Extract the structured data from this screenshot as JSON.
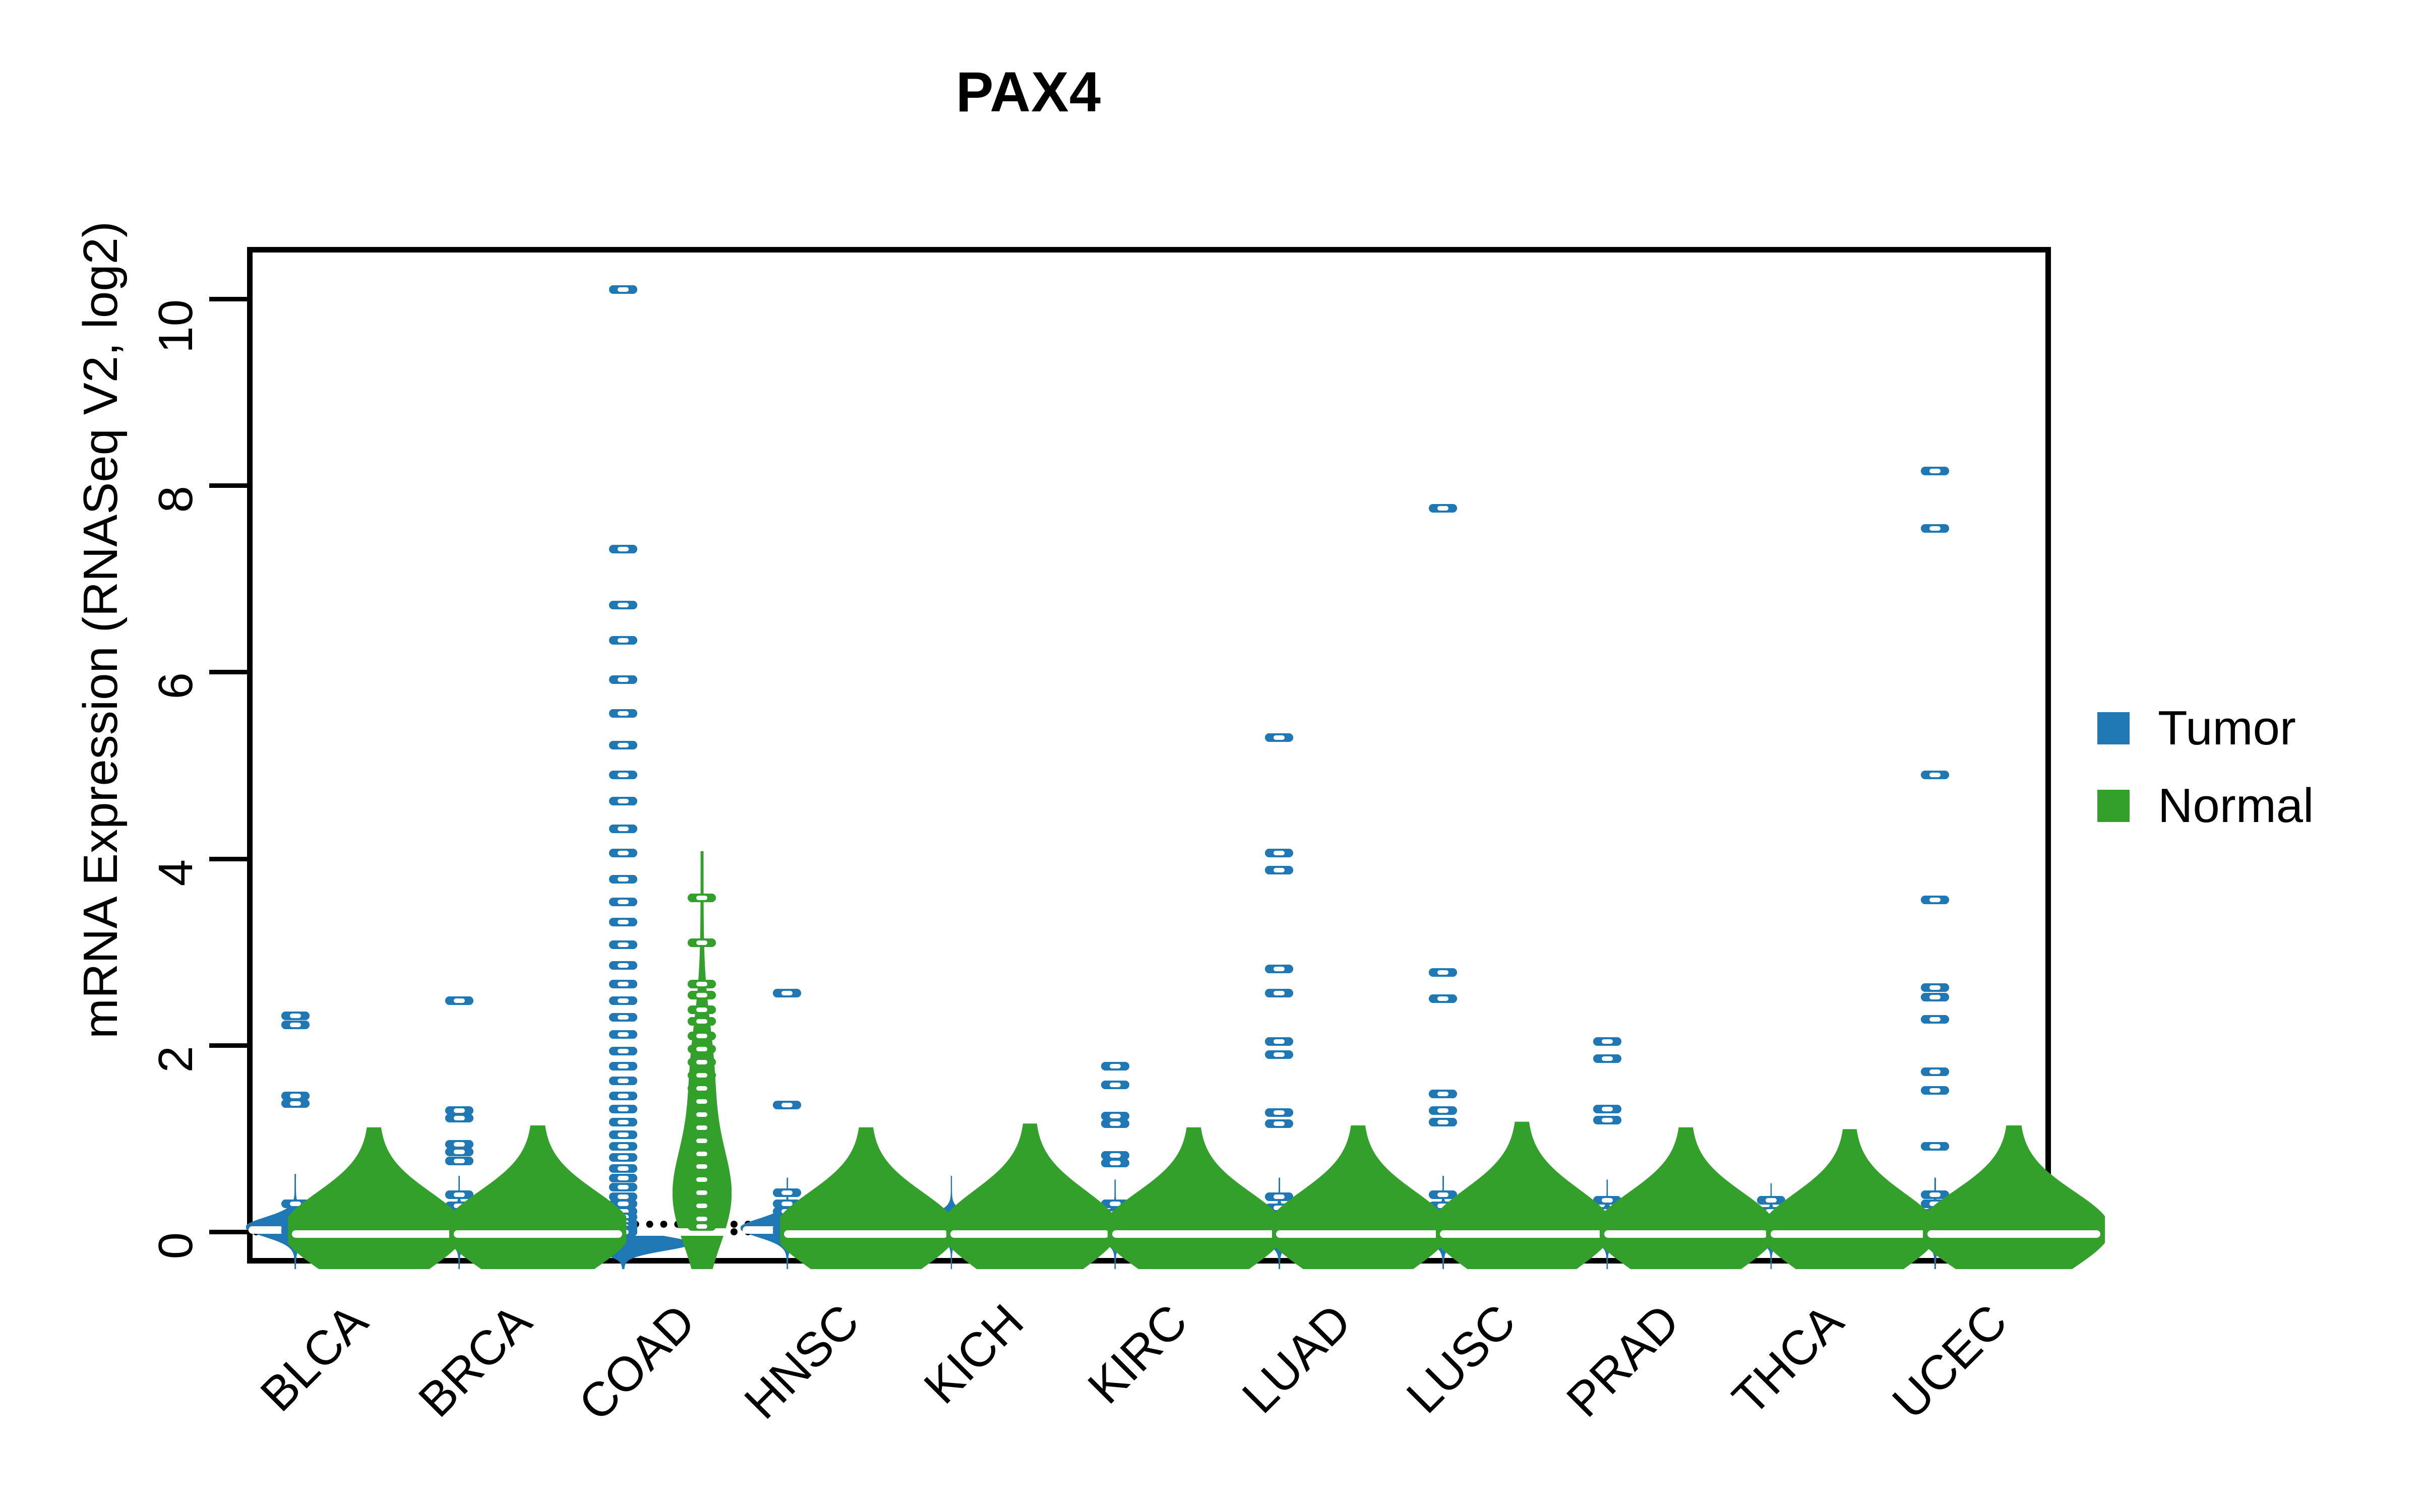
{
  "chart_data": {
    "type": "violin",
    "title": "PAX4",
    "xlabel": "",
    "ylabel": "mRNA Expression (RNASeq V2, log2)",
    "ylim": [
      -0.55,
      10.6
    ],
    "yticks": [
      0,
      2,
      4,
      6,
      8,
      10
    ],
    "ytick_labels": [
      "0",
      "2",
      "4",
      "6",
      "8",
      "10"
    ],
    "grid": false,
    "legend_position": "right",
    "categories": [
      "BLCA",
      "BRCA",
      "COAD",
      "HNSC",
      "KICH",
      "KIRC",
      "LUAD",
      "LUSC",
      "PRAD",
      "THCA",
      "UCEC"
    ],
    "reference_lines": [
      0.12,
      0.04
    ],
    "series": [
      {
        "name": "Tumor",
        "color": "#1F78B4",
        "groups": [
          {
            "category": "BLCA",
            "median": 0.02,
            "violin_top": 0.62,
            "violin_bottom": -0.52,
            "violin_width": 0.4,
            "points": [
              2.32,
              2.22,
              1.46,
              1.38,
              0.3,
              0.18,
              0.1,
              0.06,
              0.02,
              0.0,
              0.0
            ]
          },
          {
            "category": "BRCA",
            "median": 0.02,
            "violin_top": 0.6,
            "violin_bottom": -0.5,
            "violin_width": 0.38,
            "points": [
              2.48,
              1.3,
              1.22,
              0.94,
              0.86,
              0.76,
              0.4,
              0.28,
              0.18,
              0.1,
              0.04,
              0.0
            ]
          },
          {
            "category": "COAD",
            "median": 0.0,
            "violin_top": 0.3,
            "violin_bottom": -0.55,
            "violin_width": 0.55,
            "points": [
              10.1,
              7.32,
              6.72,
              6.34,
              5.92,
              5.56,
              5.22,
              4.9,
              4.62,
              4.32,
              4.06,
              3.78,
              3.54,
              3.32,
              3.08,
              2.86,
              2.66,
              2.48,
              2.3,
              2.12,
              1.94,
              1.78,
              1.62,
              1.46,
              1.32,
              1.18,
              1.04,
              0.92,
              0.8,
              0.68,
              0.58,
              0.48,
              0.38,
              0.3,
              0.22,
              0.16,
              0.1,
              0.06,
              0.02,
              0.0
            ]
          },
          {
            "category": "HNSC",
            "median": 0.02,
            "violin_top": 0.58,
            "violin_bottom": -0.5,
            "violin_width": 0.38,
            "points": [
              2.56,
              1.36,
              0.42,
              0.3,
              0.22,
              0.14,
              0.08,
              0.04,
              0.0
            ]
          },
          {
            "category": "KICH",
            "median": 0.03,
            "violin_top": 0.6,
            "violin_bottom": -0.45,
            "violin_width": 0.32,
            "points": [
              0.18,
              0.12,
              0.06,
              0.02,
              0.0
            ]
          },
          {
            "category": "KIRC",
            "median": 0.02,
            "violin_top": 0.56,
            "violin_bottom": -0.48,
            "violin_width": 0.36,
            "points": [
              1.78,
              1.58,
              1.24,
              1.16,
              0.82,
              0.74,
              0.3,
              0.2,
              0.1,
              0.04,
              0.0
            ]
          },
          {
            "category": "LUAD",
            "median": 0.02,
            "violin_top": 0.58,
            "violin_bottom": -0.52,
            "violin_width": 0.4,
            "points": [
              5.3,
              4.06,
              3.88,
              2.82,
              2.56,
              2.04,
              1.9,
              1.28,
              1.16,
              0.38,
              0.26,
              0.16,
              0.08,
              0.02,
              0.0
            ]
          },
          {
            "category": "LUSC",
            "median": 0.03,
            "violin_top": 0.6,
            "violin_bottom": -0.52,
            "violin_width": 0.4,
            "points": [
              7.76,
              2.78,
              2.5,
              1.48,
              1.3,
              1.18,
              0.4,
              0.28,
              0.18,
              0.1,
              0.04,
              0.0
            ]
          },
          {
            "category": "PRAD",
            "median": 0.02,
            "violin_top": 0.56,
            "violin_bottom": -0.48,
            "violin_width": 0.36,
            "points": [
              2.04,
              1.86,
              1.32,
              1.2,
              0.34,
              0.22,
              0.12,
              0.06,
              0.0
            ]
          },
          {
            "category": "THCA",
            "median": 0.02,
            "violin_top": 0.52,
            "violin_bottom": -0.46,
            "violin_width": 0.34,
            "points": [
              0.34,
              0.22,
              0.12,
              0.06,
              0.02,
              0.0
            ]
          },
          {
            "category": "UCEC",
            "median": 0.03,
            "violin_top": 0.58,
            "violin_bottom": -0.5,
            "violin_width": 0.44,
            "points": [
              8.16,
              7.54,
              4.9,
              3.56,
              2.62,
              2.52,
              2.28,
              1.72,
              1.52,
              0.92,
              0.4,
              0.3,
              0.2,
              0.12,
              0.06,
              0.0
            ]
          }
        ]
      },
      {
        "name": "Normal",
        "color": "#33A02C",
        "groups": [
          {
            "category": "BLCA",
            "median": -0.02,
            "violin_top": 1.12,
            "violin_bottom": -0.55,
            "violin_width": 0.7,
            "points": []
          },
          {
            "category": "BRCA",
            "median": -0.02,
            "violin_top": 1.14,
            "violin_bottom": -0.55,
            "violin_width": 0.72,
            "points": []
          },
          {
            "category": "COAD",
            "median": 0.0,
            "violin_top": 4.08,
            "violin_bottom": -0.55,
            "violin_width": 0.24,
            "points": [
              3.58,
              3.1,
              2.66,
              2.54,
              2.38,
              2.26,
              2.1,
              1.96,
              1.82,
              1.68,
              1.54,
              1.4,
              1.26,
              1.12,
              0.98,
              0.84,
              0.7,
              0.56,
              0.42,
              0.28,
              0.14,
              0.06
            ]
          },
          {
            "category": "HNSC",
            "median": -0.02,
            "violin_top": 1.12,
            "violin_bottom": -0.55,
            "violin_width": 0.7,
            "points": []
          },
          {
            "category": "KICH",
            "median": -0.02,
            "violin_top": 1.16,
            "violin_bottom": -0.55,
            "violin_width": 0.68,
            "points": []
          },
          {
            "category": "KIRC",
            "median": -0.02,
            "violin_top": 1.12,
            "violin_bottom": -0.55,
            "violin_width": 0.7,
            "points": []
          },
          {
            "category": "LUAD",
            "median": -0.02,
            "violin_top": 1.14,
            "violin_bottom": -0.55,
            "violin_width": 0.7,
            "points": []
          },
          {
            "category": "LUSC",
            "median": -0.02,
            "violin_top": 1.18,
            "violin_bottom": -0.55,
            "violin_width": 0.7,
            "points": []
          },
          {
            "category": "PRAD",
            "median": -0.02,
            "violin_top": 1.12,
            "violin_bottom": -0.55,
            "violin_width": 0.7,
            "points": []
          },
          {
            "category": "THCA",
            "median": -0.02,
            "violin_top": 1.1,
            "violin_bottom": -0.55,
            "violin_width": 0.68,
            "points": []
          },
          {
            "category": "UCEC",
            "median": -0.02,
            "violin_top": 1.14,
            "violin_bottom": -0.55,
            "violin_width": 0.74,
            "points": []
          }
        ]
      }
    ]
  },
  "legend": {
    "items": [
      {
        "label": "Tumor",
        "color": "#1F78B4"
      },
      {
        "label": "Normal",
        "color": "#33A02C"
      }
    ]
  }
}
